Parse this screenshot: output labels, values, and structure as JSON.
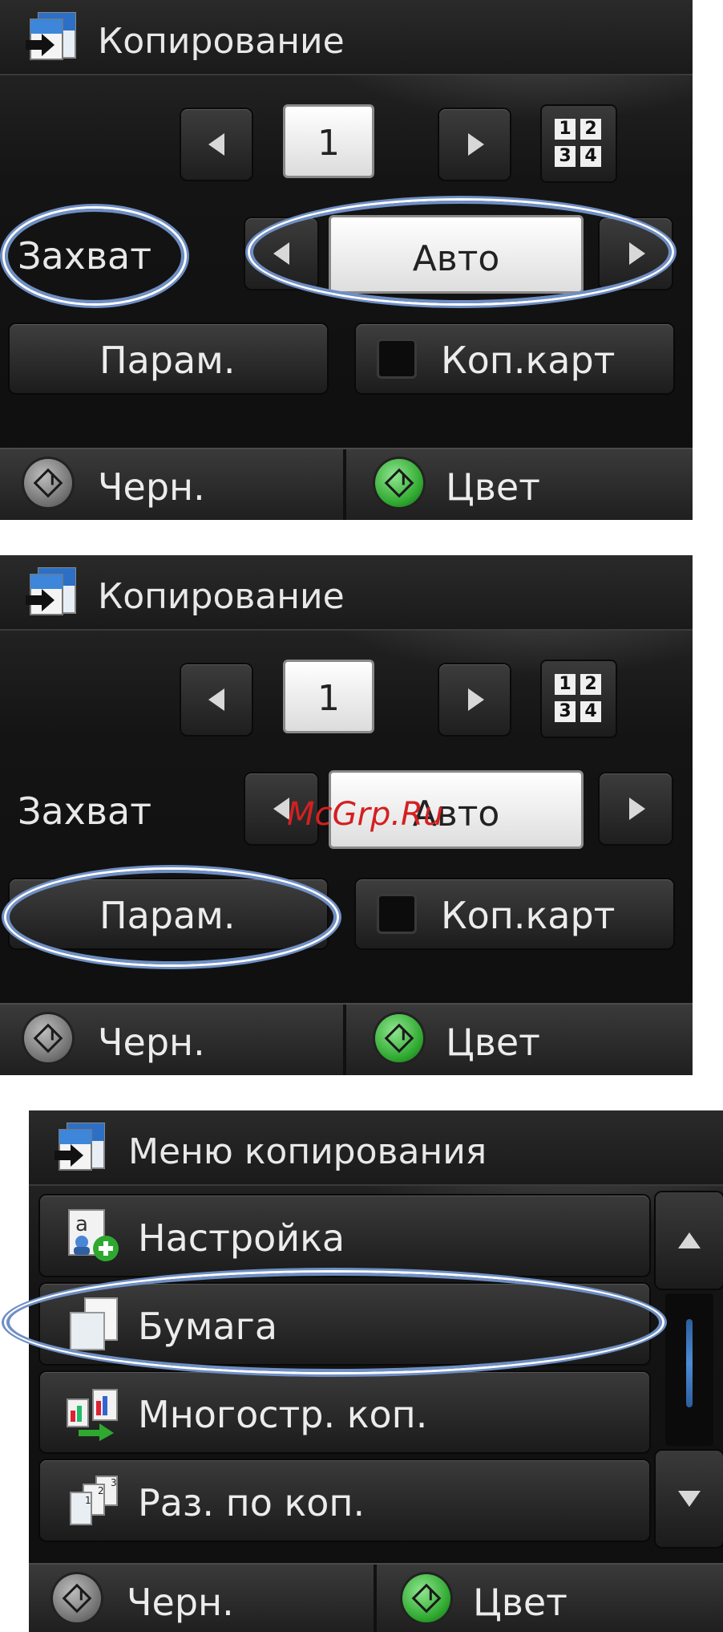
{
  "panel1": {
    "title": "Копирование",
    "copy_count": "1",
    "grid_digits": [
      "1",
      "2",
      "3",
      "4"
    ],
    "capture_label": "Захват",
    "capture_value": "Авто",
    "params_button": "Парам.",
    "collate_button": "Коп.карт",
    "black_button": "Черн.",
    "color_button": "Цвет"
  },
  "panel2": {
    "title": "Копирование",
    "copy_count": "1",
    "grid_digits": [
      "1",
      "2",
      "3",
      "4"
    ],
    "capture_label": "Захват",
    "capture_value": "Авто",
    "params_button": "Парам.",
    "collate_button": "Коп.карт",
    "black_button": "Черн.",
    "color_button": "Цвет",
    "watermark": "McGrp.Ru"
  },
  "panel3": {
    "title": "Меню копирования",
    "items": [
      {
        "label": "Настройка",
        "icon": "settings-user-icon"
      },
      {
        "label": "Бумага",
        "icon": "paper-icon"
      },
      {
        "label": "Многостр. коп.",
        "icon": "multipage-copy-icon"
      },
      {
        "label": "Раз. по коп.",
        "icon": "collate-icon"
      }
    ],
    "black_button": "Черн.",
    "color_button": "Цвет"
  },
  "colors": {
    "highlight_ellipse": "#6f8fc4",
    "green_start": "#2fa82f",
    "panel_bg": "#141414",
    "watermark": "#d42020"
  }
}
